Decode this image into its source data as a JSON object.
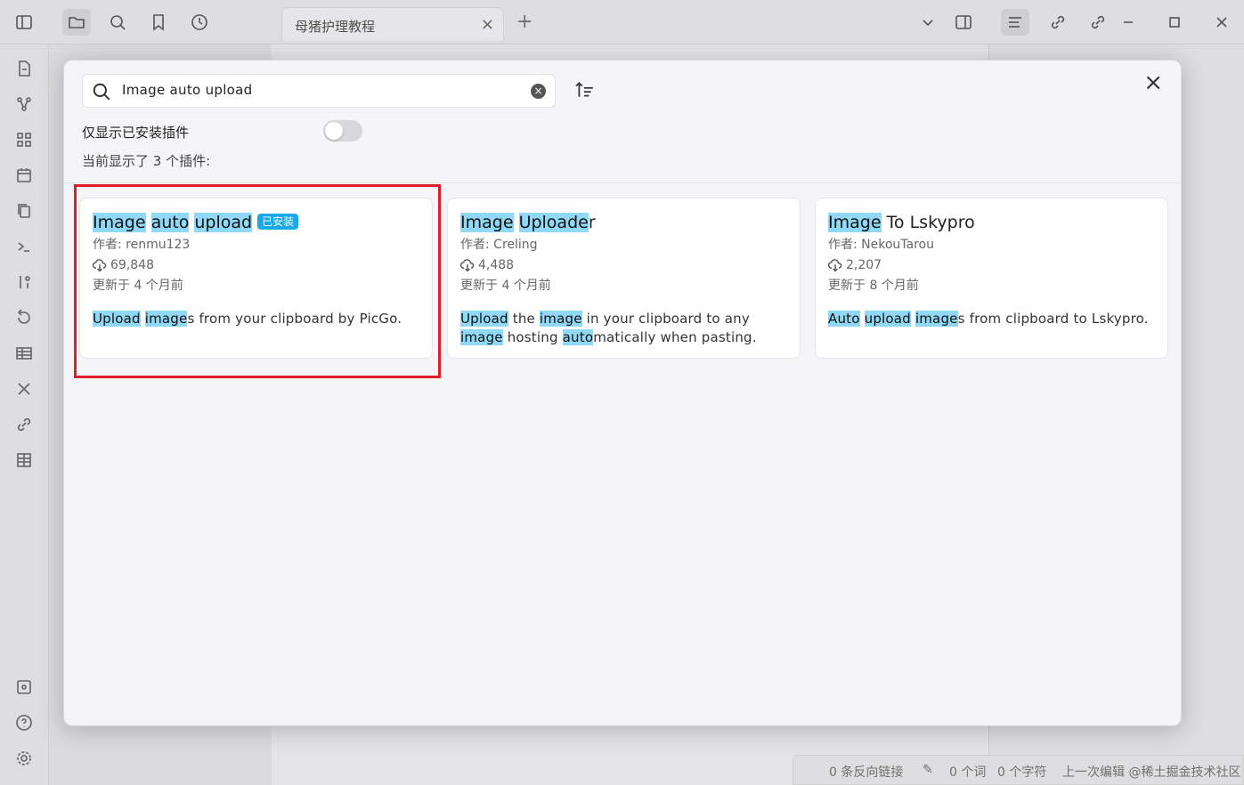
{
  "app": {
    "tab_title": "母猪护理教程",
    "tab_close": "×",
    "tab_add": "+"
  },
  "modal": {
    "close": "×",
    "search": {
      "value": "Image auto upload",
      "placeholder": ""
    },
    "filter_label": "仅显示已安装插件",
    "toggle_on": false,
    "count_label": "当前显示了 3 个插件:",
    "plugins": [
      {
        "name_parts": [
          {
            "t": "Image",
            "hl": true
          },
          {
            "t": " "
          },
          {
            "t": "auto",
            "hl": true
          },
          {
            "t": " "
          },
          {
            "t": "upload",
            "hl": true
          }
        ],
        "badge": "已安装",
        "author": "作者: renmu123",
        "downloads": "69,848",
        "updated": "更新于 4 个月前",
        "desc_parts": [
          {
            "t": "Upload",
            "hl": true
          },
          {
            "t": " "
          },
          {
            "t": "image",
            "hl": true
          },
          {
            "t": "s from your clipboard by PicGo."
          }
        ],
        "highlighted_box": true
      },
      {
        "name_parts": [
          {
            "t": "Image",
            "hl": true
          },
          {
            "t": " "
          },
          {
            "t": "Uploade",
            "hl": true
          },
          {
            "t": "r"
          }
        ],
        "badge": "",
        "author": "作者: Creling",
        "downloads": "4,488",
        "updated": "更新于 4 个月前",
        "desc_parts": [
          {
            "t": "Upload",
            "hl": true
          },
          {
            "t": " the "
          },
          {
            "t": "image",
            "hl": true
          },
          {
            "t": " in your clipboard to any "
          },
          {
            "t": "image",
            "hl": true
          },
          {
            "t": " hosting "
          },
          {
            "t": "auto",
            "hl": true
          },
          {
            "t": "matically when pasting."
          }
        ]
      },
      {
        "name_parts": [
          {
            "t": "Image",
            "hl": true
          },
          {
            "t": " To Lskypro"
          }
        ],
        "badge": "",
        "author": "作者: NekouTarou",
        "downloads": "2,207",
        "updated": "更新于 8 个月前",
        "desc_parts": [
          {
            "t": "Auto",
            "hl": true
          },
          {
            "t": " "
          },
          {
            "t": "upload",
            "hl": true
          },
          {
            "t": " "
          },
          {
            "t": "image",
            "hl": true
          },
          {
            "t": "s from clipboard to Lskypro."
          }
        ]
      }
    ]
  },
  "status": {
    "backlinks": "0 条反向链接",
    "words": "0 个词",
    "chars": "0 个字符",
    "extra": "上一次编辑 @稀土掘金技术社区"
  },
  "colors": {
    "highlight": "#8fd9f7",
    "badge": "#16a8e8",
    "annotation_box": "#e11d2a"
  }
}
